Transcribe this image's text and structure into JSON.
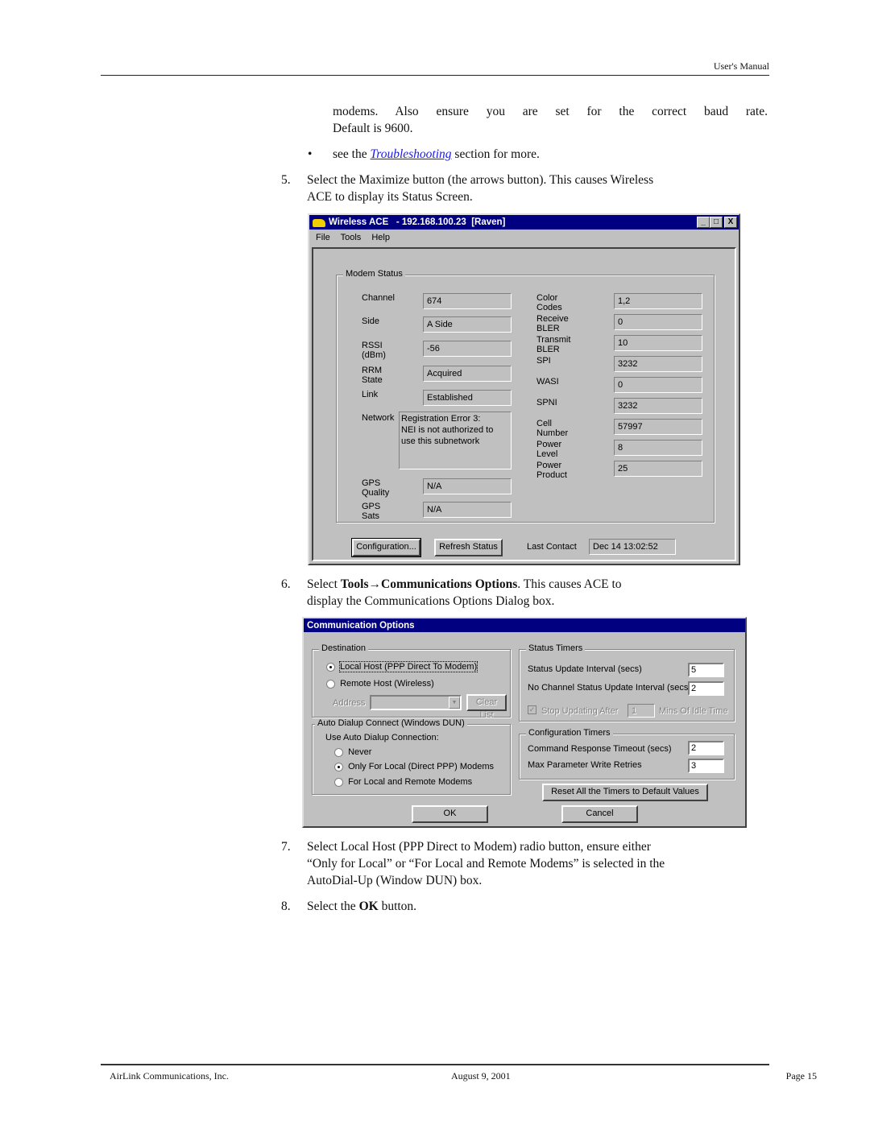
{
  "header": {
    "title": "User's Manual"
  },
  "intro": {
    "line1": "modems. Also ensure you are set for the correct baud rate.",
    "line2": "Default is 9600.",
    "bullet_prefix": "see the",
    "bullet_link": "Troubleshooting",
    "bullet_suffix": "section for more."
  },
  "steps": [
    {
      "num": "5.",
      "lines": [
        "Select the Maximize button (the arrows button). This causes Wireless",
        "ACE to display its Status Screen."
      ]
    },
    {
      "num": "6.",
      "prefix": "Select",
      "bold": "Tools→Communications Options",
      "suffix": ". This causes ACE to",
      "line2": "display the Communications Options Dialog box."
    },
    {
      "num": "7.",
      "lines": [
        "Select Local Host (PPP Direct to Modem) radio button, ensure either",
        "“Only for Local” or “For Local and Remote Modems” is selected in the",
        "AutoDial-Up (Window DUN) box."
      ]
    },
    {
      "num": "8.",
      "prefix": "Select the",
      "bold": "OK",
      "suffix": "button."
    }
  ],
  "status_window": {
    "title": "Wireless ACE   - 192.168.100.23  [Raven]",
    "icon": "antenna-modem-icon",
    "controls": [
      "_",
      "□",
      "X"
    ],
    "menu": [
      "File",
      "Tools",
      "Help"
    ],
    "group_title": "Modem Status",
    "left_fields": [
      {
        "label": "Channel",
        "value": "674"
      },
      {
        "label": "Side",
        "value": "A Side"
      },
      {
        "label": "RSSI (dBm)",
        "value": "-56"
      },
      {
        "label": "RRM State",
        "value": "Acquired"
      },
      {
        "label": "Link",
        "value": "Established"
      }
    ],
    "network": {
      "label": "Network",
      "value": "Registration Error 3:\nNEI is not authorized to\nuse this subnetwork"
    },
    "gps_fields": [
      {
        "label": "GPS Quality",
        "value": "N/A"
      },
      {
        "label": "GPS Sats",
        "value": "N/A"
      }
    ],
    "right_fields": [
      {
        "label": "Color Codes",
        "value": "1,2"
      },
      {
        "label": "Receive BLER",
        "value": "0"
      },
      {
        "label": "Transmit BLER",
        "value": "10"
      },
      {
        "label": "SPI",
        "value": "3232"
      },
      {
        "label": "WASI",
        "value": "0"
      },
      {
        "label": "SPNI",
        "value": "3232"
      },
      {
        "label": "Cell Number",
        "value": "57997"
      },
      {
        "label": "Power Level",
        "value": "8"
      },
      {
        "label": "Power Product",
        "value": "25"
      }
    ],
    "configuration_button": "Configuration...",
    "refresh_button": "Refresh Status",
    "last_contact_label": "Last Contact",
    "last_contact_value": "Dec 14  13:02:52"
  },
  "comm_dialog": {
    "title": "Communication Options",
    "destination": {
      "title": "Destination",
      "options": [
        {
          "label": "Local Host (PPP Direct To Modem)",
          "selected": true
        },
        {
          "label": "Remote Host (Wireless)",
          "selected": false
        }
      ],
      "address_label": "Address",
      "address_value": "",
      "clear_list": "Clear List"
    },
    "auto_dialup": {
      "title": "Auto Dialup Connect (Windows DUN)",
      "subtitle": "Use Auto Dialup Connection:",
      "options": [
        {
          "label": "Never",
          "selected": false
        },
        {
          "label": "Only For Local (Direct PPP) Modems",
          "selected": true
        },
        {
          "label": "For Local and Remote Modems",
          "selected": false
        }
      ]
    },
    "status_timers": {
      "title": "Status Timers",
      "update_label": "Status Update Interval (secs)",
      "update_value": "5",
      "nochan_label": "No Channel Status Update Interval (secs)",
      "nochan_value": "2",
      "stop_label": "Stop Updating After",
      "stop_checked": true,
      "stop_value": "1",
      "idle_label": "Mins Of Idle Time"
    },
    "config_timers": {
      "title": "Configuration Timers",
      "cmd_label": "Command Response Timeout (secs)",
      "cmd_value": "2",
      "retries_label": "Max Parameter Write Retries",
      "retries_value": "3"
    },
    "reset_button": "Reset All the Timers to Default Values",
    "ok_button": "OK",
    "cancel_button": "Cancel"
  },
  "footer": {
    "company": "AirLink Communications, Inc.",
    "date": "August 9, 2001",
    "page": "Page 15"
  }
}
